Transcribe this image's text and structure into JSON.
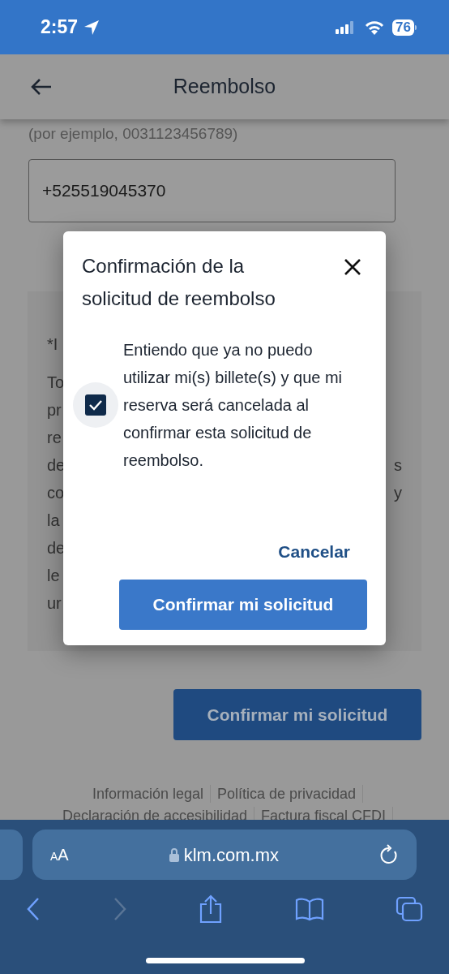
{
  "status_bar": {
    "time": "2:57",
    "battery": "76"
  },
  "header": {
    "title": "Reembolso"
  },
  "phone_hint": "(por ejemplo, 0031123456789)",
  "phone_field": {
    "value": "+525519045370"
  },
  "info_box": {
    "lines": [
      {
        "left": "*I"
      },
      {
        "left": "To"
      },
      {
        "left": "pr"
      },
      {
        "left": "re"
      },
      {
        "left": "de",
        "right": "s"
      },
      {
        "left": "co",
        "right": "y"
      },
      {
        "left": "la"
      },
      {
        "left": "de"
      },
      {
        "left": "le"
      },
      {
        "left": "ur"
      }
    ]
  },
  "submit_button": "Confirmar mi solicitud",
  "footer_links": [
    [
      "Información legal",
      "Política de privacidad"
    ],
    [
      "Declaración de accesibilidad",
      "Factura fiscal CFDI"
    ]
  ],
  "dialog": {
    "title": "Confirmación de la solicitud de reembolso",
    "checkbox": {
      "checked": true,
      "label": "Entiendo que ya no puedo utilizar mi(s) billete(s) y que mi reserva será cancelada al confirmar esta solicitud de reembolso."
    },
    "cancel": "Cancelar",
    "confirm": "Confirmar mi solicitud"
  },
  "browser": {
    "text_size": "AA",
    "url": "klm.com.mx",
    "back_disabled": false,
    "forward_disabled": true
  }
}
